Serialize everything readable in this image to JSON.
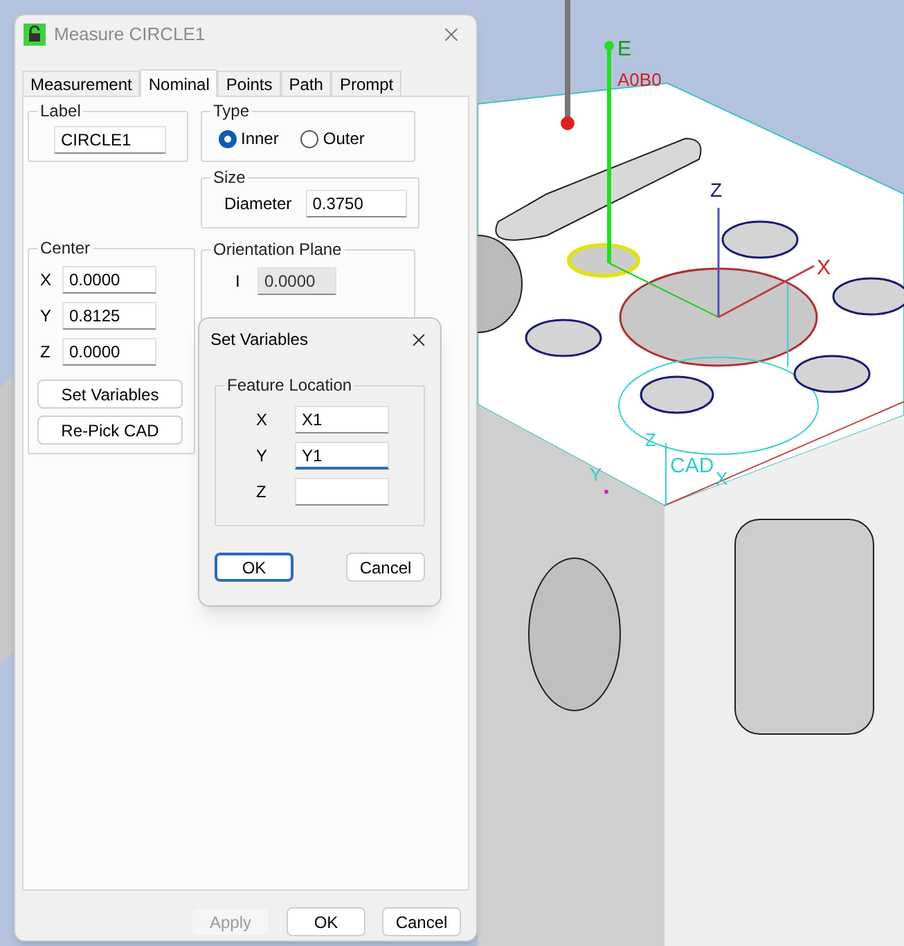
{
  "main_window": {
    "title": "Measure CIRCLE1",
    "tabs": [
      {
        "label": "Measurement",
        "selected": false
      },
      {
        "label": "Nominal",
        "selected": true
      },
      {
        "label": "Points",
        "selected": false
      },
      {
        "label": "Path",
        "selected": false
      },
      {
        "label": "Prompt",
        "selected": false
      }
    ],
    "label_group": {
      "title": "Label",
      "value": "CIRCLE1"
    },
    "type_group": {
      "title": "Type",
      "options": [
        {
          "label": "Inner",
          "selected": true
        },
        {
          "label": "Outer",
          "selected": false
        }
      ]
    },
    "size_group": {
      "title": "Size",
      "fields": [
        {
          "label": "Diameter",
          "value": "0.3750"
        }
      ]
    },
    "center_group": {
      "title": "Center",
      "fields": [
        {
          "label": "X",
          "value": "0.0000"
        },
        {
          "label": "Y",
          "value": "0.8125"
        },
        {
          "label": "Z",
          "value": "0.0000"
        }
      ],
      "buttons": [
        "Set Variables",
        "Re-Pick CAD"
      ]
    },
    "orientation_group": {
      "title": "Orientation Plane",
      "fields": [
        {
          "label": "I",
          "value": "0.0000",
          "disabled": true
        }
      ]
    },
    "buttons": [
      {
        "label": "Apply",
        "disabled": true
      },
      {
        "label": "OK",
        "disabled": false
      },
      {
        "label": "Cancel",
        "disabled": false
      }
    ]
  },
  "set_variables_dialog": {
    "title": "Set Variables",
    "group": {
      "title": "Feature Location",
      "fields": [
        {
          "label": "X",
          "value": "X1",
          "focused": false
        },
        {
          "label": "Y",
          "value": "Y1",
          "focused": true
        },
        {
          "label": "Z",
          "focused": false
        }
      ]
    },
    "buttons": [
      {
        "label": "OK",
        "default": true
      },
      {
        "label": "Cancel",
        "default": false
      }
    ]
  },
  "viewport": {
    "labels": [
      {
        "text": "E",
        "color": "#109a10"
      },
      {
        "text": "A0B0",
        "color": "#cc2222"
      },
      {
        "text": "Z",
        "color": "#1a1a80"
      },
      {
        "text": "X",
        "color": "#cc2222"
      },
      {
        "text": "Z",
        "color": "#33cccc"
      },
      {
        "text": "CAD",
        "color": "#33cccc"
      },
      {
        "text": "X",
        "color": "#33cccc"
      },
      {
        "text": "Y",
        "color": "#33cccc"
      }
    ]
  }
}
